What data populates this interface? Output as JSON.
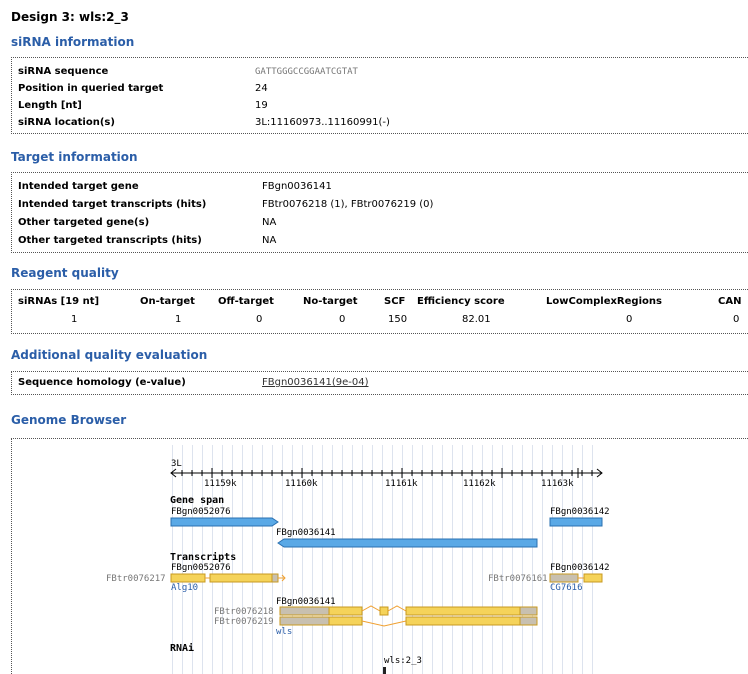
{
  "page_title": "Design 3: wls:2_3",
  "sirna_info": {
    "title": "siRNA information",
    "rows": [
      {
        "label": "siRNA sequence",
        "value": "GATTGGGCCGGAATCGTAT"
      },
      {
        "label": "Position in queried target",
        "value": "24"
      },
      {
        "label": "Length [nt]",
        "value": "19"
      },
      {
        "label": "siRNA location(s)",
        "value": "3L:11160973..11160991(-)"
      }
    ]
  },
  "target_info": {
    "title": "Target information",
    "rows": [
      {
        "label": "Intended target gene",
        "value": "FBgn0036141"
      },
      {
        "label": "Intended target transcripts (hits)",
        "value": "FBtr0076218 (1), FBtr0076219 (0)"
      },
      {
        "label": "Other targeted gene(s)",
        "value": "NA"
      },
      {
        "label": "Other targeted transcripts (hits)",
        "value": "NA"
      }
    ]
  },
  "reagent_quality": {
    "title": "Reagent quality",
    "headers": [
      "siRNAs [19 nt]",
      "On-target",
      "Off-target",
      "No-target",
      "SCF",
      "Efficiency score",
      "LowComplexRegions",
      "CAN"
    ],
    "values": [
      "1",
      "1",
      "0",
      "0",
      "150",
      "82.01",
      "0",
      "0"
    ]
  },
  "additional_quality": {
    "title": "Additional quality evaluation",
    "label": "Sequence homology (e-value)",
    "value": "FBgn0036141(9e-04)"
  },
  "genome_browser": {
    "title": "Genome Browser",
    "chrom": "3L",
    "ticks": [
      "11159k",
      "11160k",
      "11161k",
      "11162k",
      "11163k"
    ],
    "gene_span_label": "Gene span",
    "transcripts_label": "Transcripts",
    "rnai_label": "RNAi",
    "genes": [
      "FBgn0052076",
      "FBgn0036141",
      "FBgn0036142"
    ],
    "transcripts": [
      "FBtr0076217",
      "FBtr0076161",
      "FBtr0076218",
      "FBtr0076219"
    ],
    "gene_names": [
      "Alg10",
      "CG7616",
      "wls"
    ],
    "rnai_name": "wls:2_3",
    "colors": {
      "gene": "#5aa9e6",
      "exon": "#f5d35a",
      "utr": "#c8c0b0",
      "strand": "#f0a030",
      "grid": "#dde3ee"
    }
  }
}
